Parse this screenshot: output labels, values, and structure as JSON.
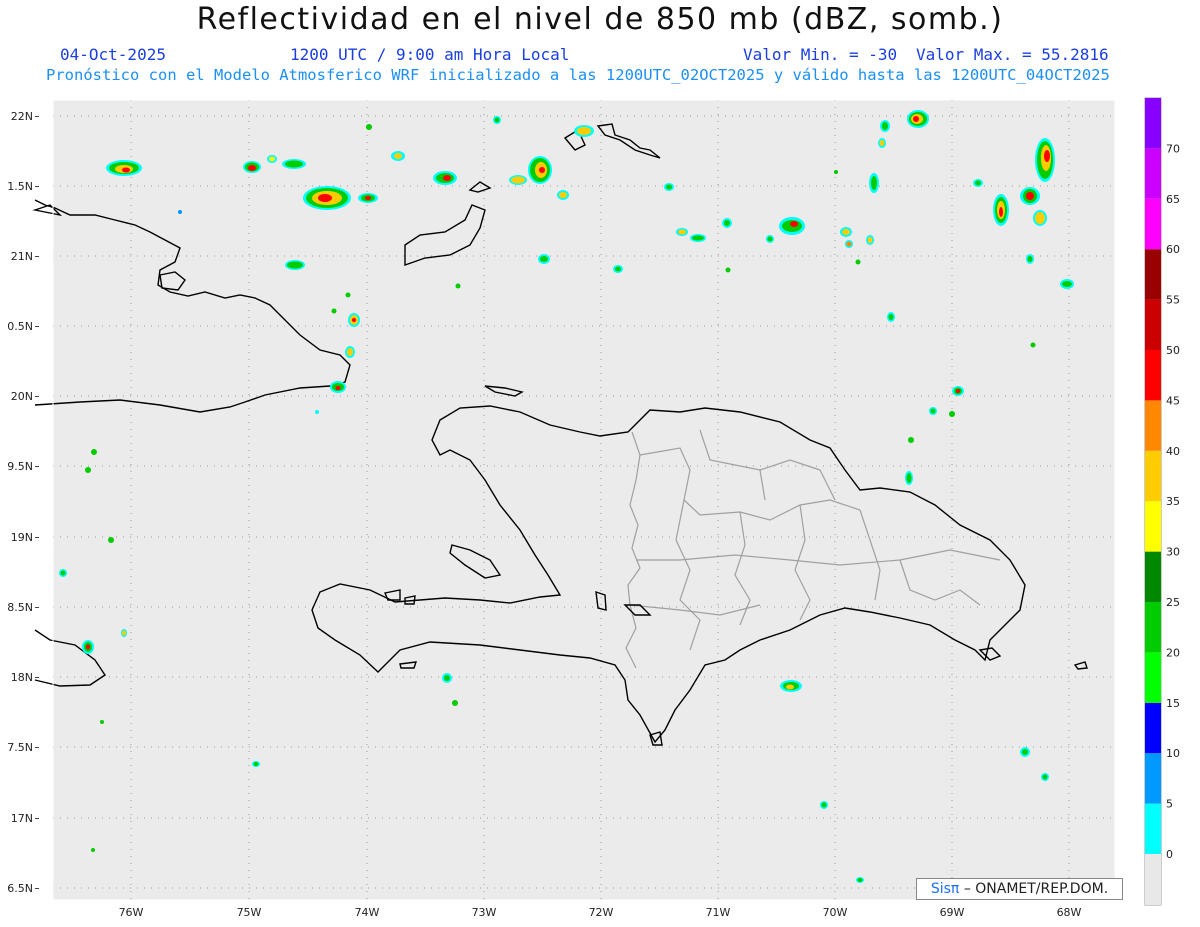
{
  "header": {
    "title": "Reflectividad en el nivel de 850 mb (dBZ, somb.)",
    "date": "04-Oct-2025",
    "time": "1200 UTC / 9:00 am Hora Local",
    "min_label": "Valor Min. = -30",
    "max_label": "Valor Max. = 55.2816",
    "forecast_line": "Pronóstico con el Modelo Atmosferico WRF inicializado a las 1200UTC_02OCT2025 y válido hasta las  1200UTC_04OCT2025"
  },
  "axes": {
    "lon_labels": [
      "76W",
      "75W",
      "74W",
      "73W",
      "72W",
      "71W",
      "70W",
      "69W",
      "68W"
    ],
    "lat_labels": [
      "22N",
      "1.5N",
      "21N",
      "0.5N",
      "20N",
      "9.5N",
      "19N",
      "8.5N",
      "18N",
      "7.5N",
      "17N",
      "6.5N"
    ]
  },
  "legend": {
    "levels": [
      "0",
      "5",
      "10",
      "15",
      "20",
      "25",
      "30",
      "35",
      "40",
      "45",
      "50",
      "55",
      "60",
      "65",
      "70"
    ],
    "colors": [
      "#00ffff",
      "#0099ff",
      "#0000ff",
      "#00ff00",
      "#00cc00",
      "#008800",
      "#ffff00",
      "#ffcc00",
      "#ff8800",
      "#ff0000",
      "#cc0000",
      "#990000",
      "#ff00ff",
      "#cc00ff",
      "#8800ff"
    ],
    "base_color": "#e8e8e8"
  },
  "credit": {
    "sis": "Sisπ",
    "text": "– ONAMET/REP.DOM."
  },
  "colors": {
    "map_bg": "#ebebeb",
    "coast": "#000000",
    "provinces": "#a0a0a0",
    "title_blue": "#1a3fe0",
    "cyan_blue": "#1b8ff5"
  }
}
